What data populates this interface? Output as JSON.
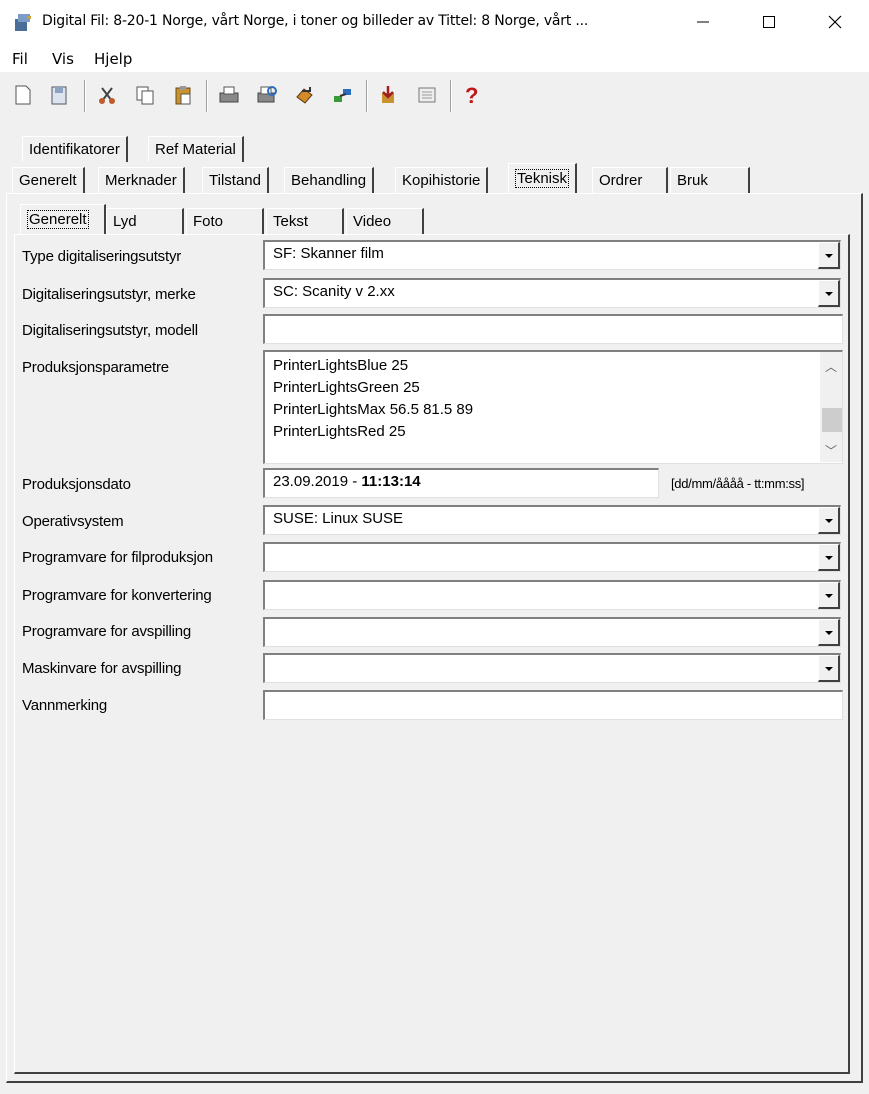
{
  "window": {
    "title": "Digital Fil: 8-20-1 Norge, vårt Norge, i toner og billeder av Tittel: 8 Norge, vårt ...",
    "minimize": "—",
    "maximize": "☐",
    "close": "✕"
  },
  "menu": [
    "Fil",
    "Vis",
    "Hjelp"
  ],
  "toolbar_icons": [
    "new-icon",
    "open-icon",
    "cut-icon",
    "copy-icon",
    "paste-icon",
    "print-icon",
    "print-preview-icon",
    "refresh-icon",
    "link-icon",
    "import-icon",
    "list-icon",
    "help-icon"
  ],
  "tabs_row1": [
    "Identifikatorer",
    "Ref Material"
  ],
  "tabs_row2": [
    "Generelt",
    "Merknader",
    "Tilstand",
    "Behandling",
    "Kopihistorie",
    "Teknisk",
    "Ordrer",
    "Bruk"
  ],
  "tabs_row2_active": "Teknisk",
  "subtabs": [
    "Generelt",
    "Lyd",
    "Foto",
    "Tekst",
    "Video"
  ],
  "subtabs_active": "Generelt",
  "form": {
    "type_label": "Type digitaliseringsutstyr",
    "type_value": "SF: Skanner film",
    "merke_label": "Digitaliseringsutstyr, merke",
    "merke_value": "SC: Scanity v 2.xx",
    "modell_label": "Digitaliseringsutstyr, modell",
    "modell_value": "",
    "param_label": "Produksjonsparametre",
    "param_lines": [
      "PrinterLightsBlue 25",
      "PrinterLightsGreen 25",
      "PrinterLightsMax 56.5 81.5 89",
      "PrinterLightsRed 25"
    ],
    "dato_label": "Produksjonsdato",
    "dato_date": "23.09.2019 - ",
    "dato_time": "11:13:14",
    "dato_hint": "[dd/mm/åååå - tt:mm:ss]",
    "os_label": "Operativsystem",
    "os_value": "SUSE: Linux SUSE",
    "filprod_label": "Programvare for filproduksjon",
    "filprod_value": "",
    "konv_label": "Programvare for konvertering",
    "konv_value": "",
    "avsp_label": "Programvare for avspilling",
    "avsp_value": "",
    "mask_label": "Maskinvare for avspilling",
    "mask_value": "",
    "vann_label": "Vannmerking",
    "vann_value": ""
  }
}
